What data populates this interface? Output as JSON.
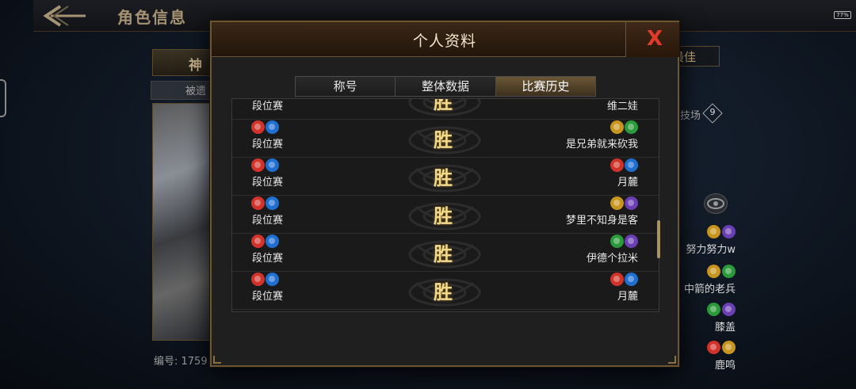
{
  "header": {
    "title": "角色信息",
    "battery": "77%"
  },
  "background": {
    "tab_label": "神",
    "sub_label": "被遗",
    "id_label": "编号: 1759",
    "best_label": "最佳",
    "arena_label": "技场",
    "arena_count": "9",
    "side_players": [
      {
        "name": "努力努力w",
        "icons": [
          "#c8961e",
          "#6a3fb4"
        ]
      },
      {
        "name": "中箭的老兵",
        "icons": [
          "#c8961e",
          "#2a9a3a"
        ]
      },
      {
        "name": "膝盖",
        "icons": [
          "#2a9a3a",
          "#6a3fb4"
        ]
      },
      {
        "name": "鹿鸣",
        "icons": [
          "#d1332a",
          "#c8961e"
        ]
      }
    ]
  },
  "modal": {
    "title": "个人资料",
    "close_symbol": "X",
    "tabs": [
      {
        "label": "称号",
        "active": false
      },
      {
        "label": "整体数据",
        "active": false
      },
      {
        "label": "比赛历史",
        "active": true
      }
    ],
    "matches": [
      {
        "mode": "段位赛",
        "result": "胜",
        "opponent": "维二娃",
        "my_icons": [
          "#d1332a",
          "#1f6fd1"
        ],
        "opp_icons": [
          "#c8961e",
          "#6a3fb4"
        ]
      },
      {
        "mode": "段位赛",
        "result": "胜",
        "opponent": "是兄弟就来砍我",
        "my_icons": [
          "#d1332a",
          "#1f6fd1"
        ],
        "opp_icons": [
          "#c8961e",
          "#2a9a3a"
        ]
      },
      {
        "mode": "段位赛",
        "result": "胜",
        "opponent": "月麓",
        "my_icons": [
          "#d1332a",
          "#1f6fd1"
        ],
        "opp_icons": [
          "#d1332a",
          "#1f6fd1"
        ]
      },
      {
        "mode": "段位赛",
        "result": "胜",
        "opponent": "梦里不知身是客",
        "my_icons": [
          "#d1332a",
          "#1f6fd1"
        ],
        "opp_icons": [
          "#c8961e",
          "#6a3fb4"
        ]
      },
      {
        "mode": "段位赛",
        "result": "胜",
        "opponent": "伊德个拉米",
        "my_icons": [
          "#d1332a",
          "#1f6fd1"
        ],
        "opp_icons": [
          "#2a9a3a",
          "#6a3fb4"
        ]
      },
      {
        "mode": "段位赛",
        "result": "胜",
        "opponent": "月麓",
        "my_icons": [
          "#d1332a",
          "#1f6fd1"
        ],
        "opp_icons": [
          "#d1332a",
          "#1f6fd1"
        ]
      }
    ]
  }
}
